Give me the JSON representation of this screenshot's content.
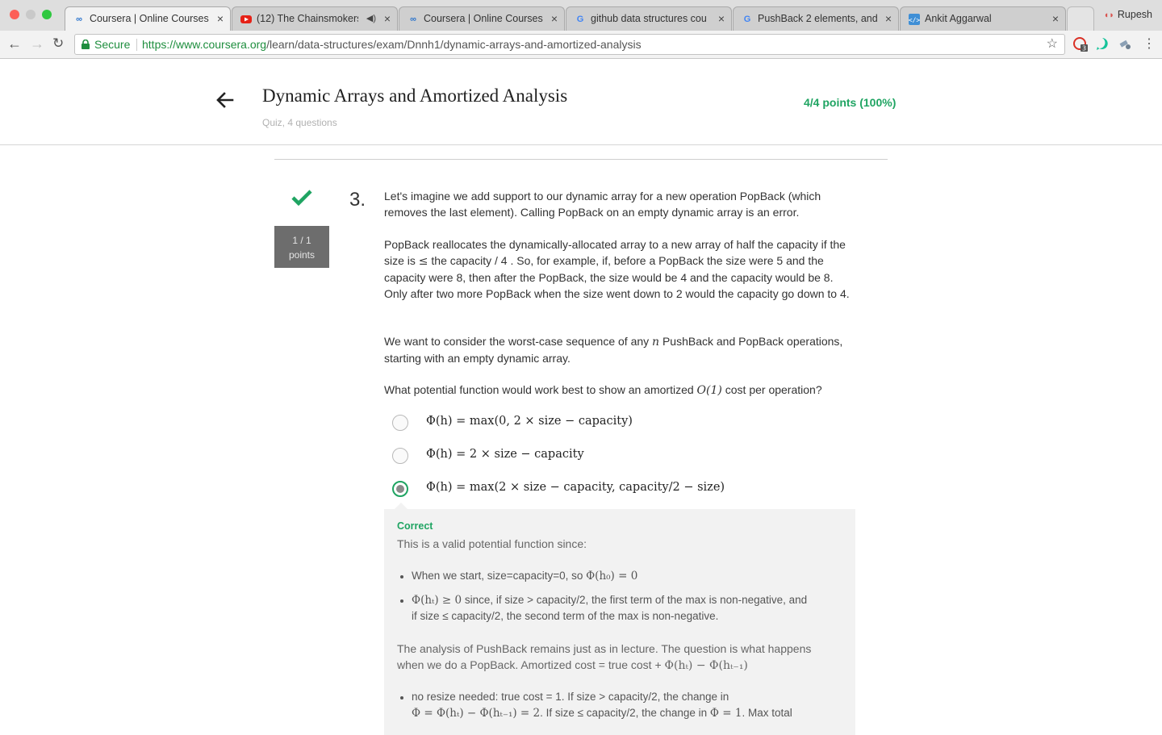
{
  "browser": {
    "tabs": [
      {
        "title": "Coursera | Online Courses",
        "icon": "coursera-icon",
        "active": true
      },
      {
        "title": "(12) The Chainsmokers",
        "icon": "youtube-icon",
        "audio": true
      },
      {
        "title": "Coursera | Online Courses",
        "icon": "coursera-icon"
      },
      {
        "title": "github data structures cou",
        "icon": "google-icon"
      },
      {
        "title": "PushBack 2 elements, and",
        "icon": "google-icon"
      },
      {
        "title": "Ankit Aggarwal",
        "icon": "code-icon"
      }
    ],
    "profile_name": "Rupesh",
    "secure_label": "Secure",
    "url_scheme_host": "https://www.coursera.org",
    "url_path": "/learn/data-structures/exam/Dnnh1/dynamic-arrays-and-amortized-analysis",
    "extension_badge": "3",
    "colors": {
      "accent": "#1fa462",
      "tabstrip": "#dedede"
    }
  },
  "header": {
    "title": "Dynamic Arrays and Amortized Analysis",
    "subtitle": "Quiz, 4 questions",
    "score": "4/4 points (100%)"
  },
  "question": {
    "points_line1": "1 / 1",
    "points_line2": "points",
    "number": "3.",
    "para1": "Let's imagine we add support to our dynamic array for a new operation PopBack (which removes the last element). Calling PopBack on an empty dynamic array is an error.",
    "para2_a": "PopBack reallocates the dynamically-allocated array to a new array of half the capacity if the size is ",
    "para2_sym": "≤",
    "para2_b": " the capacity / 4 . So, for example, if, before a PopBack the size were 5 and the capacity were 8, then after the PopBack, the size would be 4 and the capacity would be 8. Only after two more PopBack when the size went down to 2 would the capacity go down to 4.",
    "para3_a": "We want to consider the worst-case sequence of any ",
    "para3_n": "n",
    "para3_b": " PushBack and PopBack operations, starting with an empty dynamic array.",
    "para4_a": "What potential function would work best to show an amortized ",
    "para4_o": "O(1)",
    "para4_b": " cost per operation?",
    "options": [
      {
        "label": "Φ(h) = max(0, 2 × size − capacity)",
        "selected": false
      },
      {
        "label": "Φ(h) = 2 × size − capacity",
        "selected": false
      },
      {
        "label": "Φ(h) = max(2 × size − capacity, capacity/2 − size)",
        "selected": true
      }
    ]
  },
  "feedback": {
    "label": "Correct",
    "intro": "This is a valid potential function since:",
    "bullet1_text": "When we start, size=capacity=0, so ",
    "bullet1_math": "Φ(h₀) = 0",
    "bullet2_math": "Φ(hₜ) ≥ 0",
    "bullet2_text": " since, if size > capacity/2, the first term of the max is non-negative, and if size ≤ capacity/2, the second term of the max is non-negative.",
    "analysis_text": "The analysis of PushBack remains just as in lecture. The question is what happens when we do a PopBack. Amortized cost = true cost + ",
    "analysis_math": "Φ(hₜ) − Φ(hₜ₋₁)",
    "bullet3_text1": "no resize needed: true cost = 1. If size > capacity/2, the change in",
    "bullet3_math1": "Φ = Φ(hₜ) − Φ(hₜ₋₁) = 2",
    "bullet3_text2": ". If size ≤ capacity/2, the change in ",
    "bullet3_math2": "Φ = 1",
    "bullet3_text3": ". Max total"
  }
}
